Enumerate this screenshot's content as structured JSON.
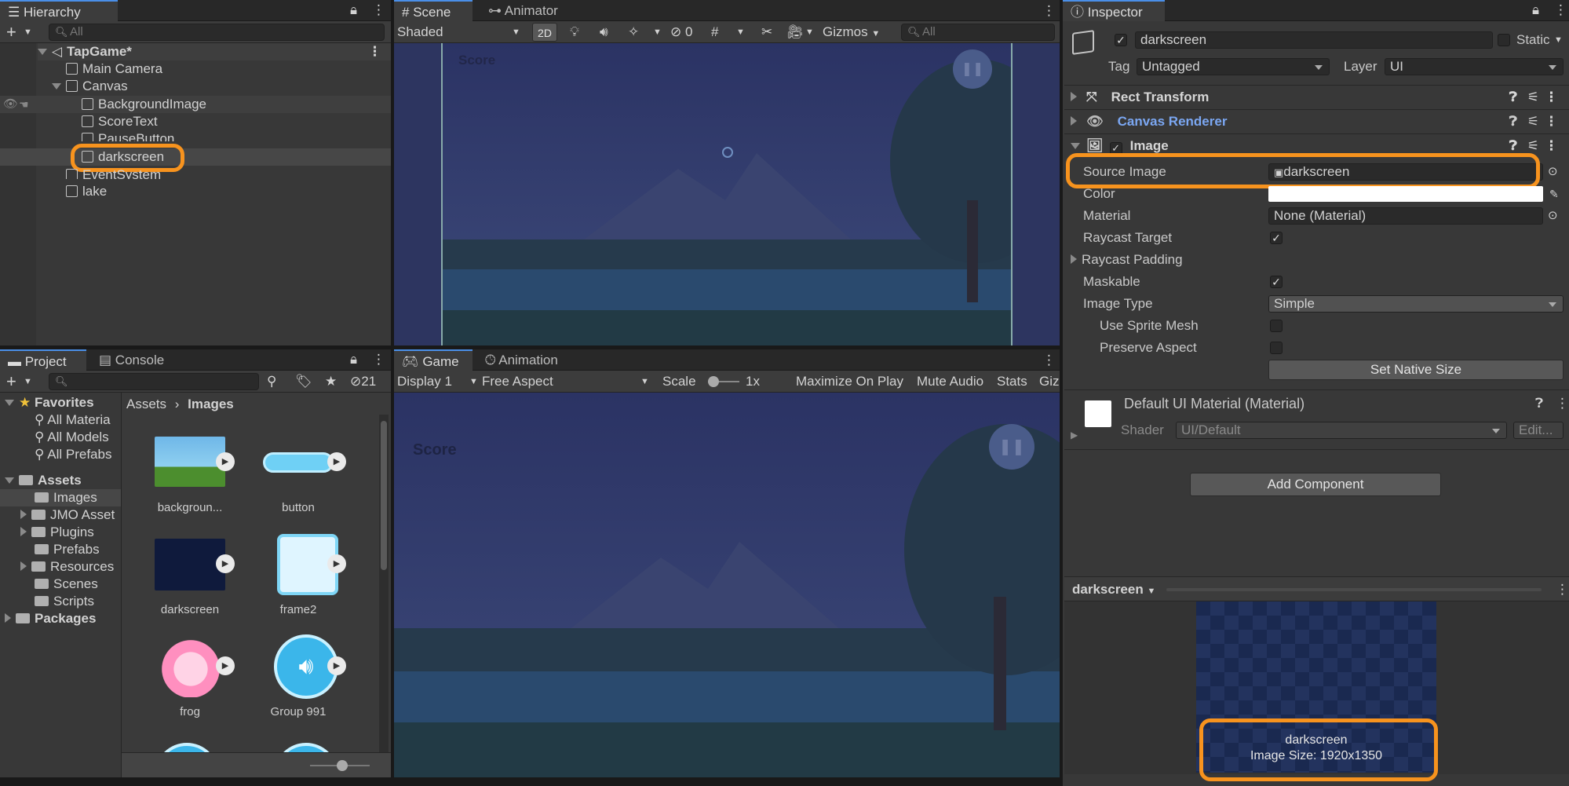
{
  "hierarchy": {
    "tab": "Hierarchy",
    "search_placeholder": "All",
    "scene_name": "TapGame*",
    "items": [
      "Main Camera",
      "Canvas",
      "BackgroundImage",
      "ScoreText",
      "PauseButton",
      "darkscreen",
      "EventSystem",
      "lake"
    ]
  },
  "scene": {
    "tabs": [
      "Scene",
      "Animator"
    ],
    "shading": "Shaded",
    "mode2d": "2D",
    "hidden_count": "0",
    "gizmos": "Gizmos",
    "search_placeholder": "All",
    "score_label": "Score"
  },
  "inspector": {
    "tab": "Inspector",
    "object_name": "darkscreen",
    "static_label": "Static",
    "tag_label": "Tag",
    "tag_value": "Untagged",
    "layer_label": "Layer",
    "layer_value": "UI",
    "components": {
      "rect_transform": "Rect Transform",
      "canvas_renderer": "Canvas Renderer",
      "image": "Image"
    },
    "props": {
      "source_image_label": "Source Image",
      "source_image_value": "darkscreen",
      "color_label": "Color",
      "material_label": "Material",
      "material_value": "None (Material)",
      "raycast_target_label": "Raycast Target",
      "raycast_padding_label": "Raycast Padding",
      "maskable_label": "Maskable",
      "image_type_label": "Image Type",
      "image_type_value": "Simple",
      "use_sprite_mesh_label": "Use Sprite Mesh",
      "preserve_aspect_label": "Preserve Aspect",
      "set_native_size": "Set Native Size"
    },
    "material_block": {
      "title": "Default UI Material (Material)",
      "shader_label": "Shader",
      "shader_value": "UI/Default",
      "edit": "Edit..."
    },
    "add_component": "Add Component",
    "preview": {
      "dropdown": "darkscreen",
      "name": "darkscreen",
      "size": "Image Size: 1920x1350"
    },
    "colors": {
      "color_field": "#ffffff",
      "highlight": "#f7931e"
    }
  },
  "project": {
    "tabs": [
      "Project",
      "Console"
    ],
    "hidden_count": "21",
    "favorites_label": "Favorites",
    "favorites": [
      "All Materia",
      "All Models",
      "All Prefabs"
    ],
    "assets_label": "Assets",
    "folders": [
      "Images",
      "JMO Asset",
      "Plugins",
      "Prefabs",
      "Resources",
      "Scenes",
      "Scripts"
    ],
    "packages_label": "Packages",
    "breadcrumb": [
      "Assets",
      "Images"
    ],
    "assets": [
      "backgroun...",
      "button",
      "darkscreen",
      "frame2",
      "frog",
      "Group 991"
    ]
  },
  "game": {
    "tabs": [
      "Game",
      "Animation"
    ],
    "display": "Display 1",
    "aspect": "Free Aspect",
    "scale_label": "Scale",
    "scale_value": "1x",
    "maximize": "Maximize On Play",
    "mute": "Mute Audio",
    "stats": "Stats",
    "gizmos_cut": "Giz",
    "score_label": "Score"
  }
}
